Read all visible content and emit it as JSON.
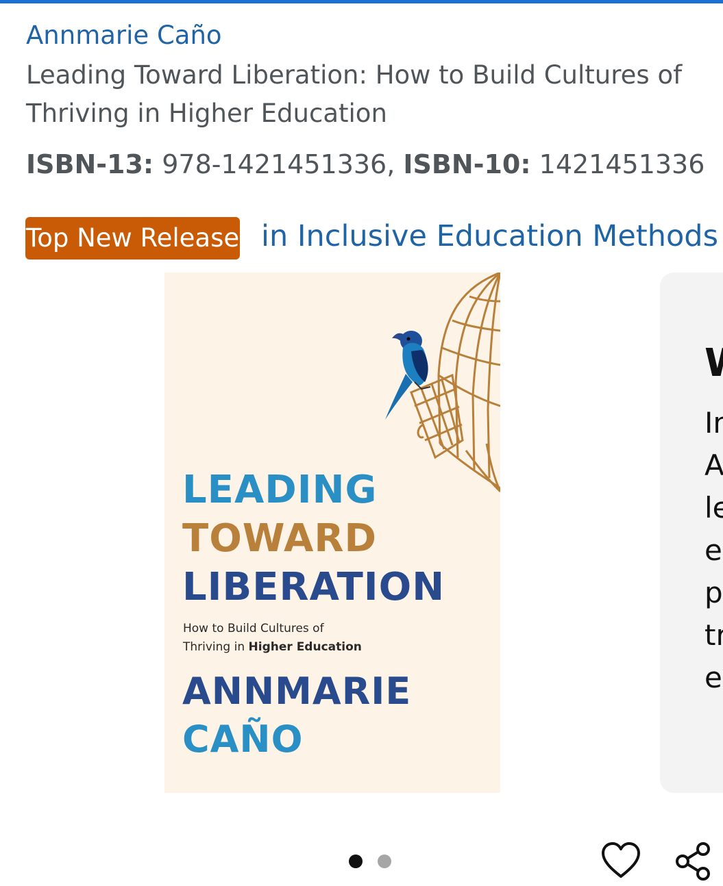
{
  "product": {
    "author": "Annmarie Caño",
    "title": "Leading Toward Liberation: How to Build Cultures of Thriving in Higher Education",
    "isbn13_label": "ISBN-13:",
    "isbn13_value": "978-1421451336",
    "isbn_separator": ",",
    "isbn10_label": "ISBN-10:",
    "isbn10_value": "1421451336"
  },
  "badge": {
    "label": "Top New Release",
    "category": "in Inclusive Education Methods",
    "color": "#c95a06"
  },
  "cover": {
    "line1": "LEADING",
    "line2": "TOWARD",
    "line3": "LIBERATION",
    "subtitle_line1": "How to Build Cultures of",
    "subtitle_line2_plain": "Thriving in",
    "subtitle_line2_bold": "Higher Education",
    "author_line1": "ANNMARIE",
    "author_line2": "CAÑO"
  },
  "side_card": {
    "heading": "W",
    "lines": [
      "In",
      "A",
      "le",
      "er",
      "p",
      "tr",
      "ec"
    ]
  },
  "carousel": {
    "page_count": 2,
    "active_index": 0
  },
  "actions": {
    "wishlist_icon": "heart-icon",
    "share_icon": "share-icon"
  },
  "colors": {
    "link": "#1f64a6",
    "text": "#4f5559",
    "accent_bar": "#1a6fd0"
  }
}
